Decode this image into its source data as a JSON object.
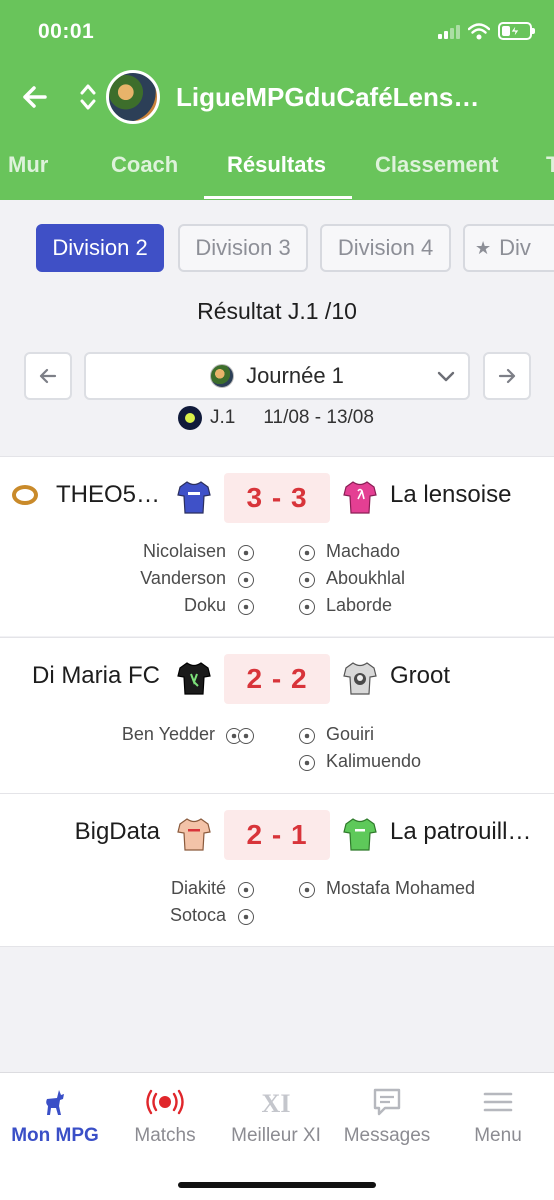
{
  "status_bar": {
    "time": "00:01"
  },
  "header": {
    "league_name": "LigueMPGduCaféLens…"
  },
  "tabs": [
    {
      "label": "Mur"
    },
    {
      "label": "Coach"
    },
    {
      "label": "Résultats"
    },
    {
      "label": "Classement"
    },
    {
      "label": "T"
    }
  ],
  "divisions": [
    {
      "label": "Division 2"
    },
    {
      "label": "Division 3"
    },
    {
      "label": "Division 4"
    },
    {
      "label": "Div"
    }
  ],
  "result_title": "Résultat J.1 /10",
  "day_selector": {
    "value": "Journée 1"
  },
  "round": {
    "label": "J.1",
    "dates": "11/08 - 13/08"
  },
  "matches": [
    {
      "home": "THEO5…",
      "away": "La lensoise",
      "score": "3 - 3",
      "home_jersey_color": "#3f51c8",
      "away_jersey_color": "#e43f93",
      "home_scorers": [
        "Nicolaisen",
        "Vanderson",
        "Doku"
      ],
      "away_scorers": [
        "Machado",
        "Aboukhlal",
        "Laborde"
      ]
    },
    {
      "home": "Di Maria FC",
      "away": "Groot",
      "score": "2 - 2",
      "home_jersey_color": "#1b1b1b",
      "away_jersey_color": "#cfcfcf",
      "home_scorers": [
        "Ben Yedder"
      ],
      "away_scorers": [
        "Gouiri",
        "Kalimuendo"
      ]
    },
    {
      "home": "BigData",
      "away": "La patrouill…",
      "score": "2 - 1",
      "home_jersey_color": "#f3c3a8",
      "away_jersey_color": "#5ec95a",
      "home_scorers": [
        "Diakité",
        "Sotoca"
      ],
      "away_scorers": [
        "Mostafa Mohamed"
      ]
    }
  ],
  "bottom_nav": [
    {
      "label": "Mon MPG",
      "icon": "goat-icon"
    },
    {
      "label": "Matchs",
      "icon": "live-icon"
    },
    {
      "label": "Meilleur XI",
      "icon": "xi-icon"
    },
    {
      "label": "Messages",
      "icon": "message-icon"
    },
    {
      "label": "Menu",
      "icon": "menu-icon"
    }
  ],
  "colors": {
    "header_green": "#69c45b",
    "accent_blue": "#3f50c6",
    "score_red": "#d8343a",
    "live_red": "#e0262b"
  }
}
